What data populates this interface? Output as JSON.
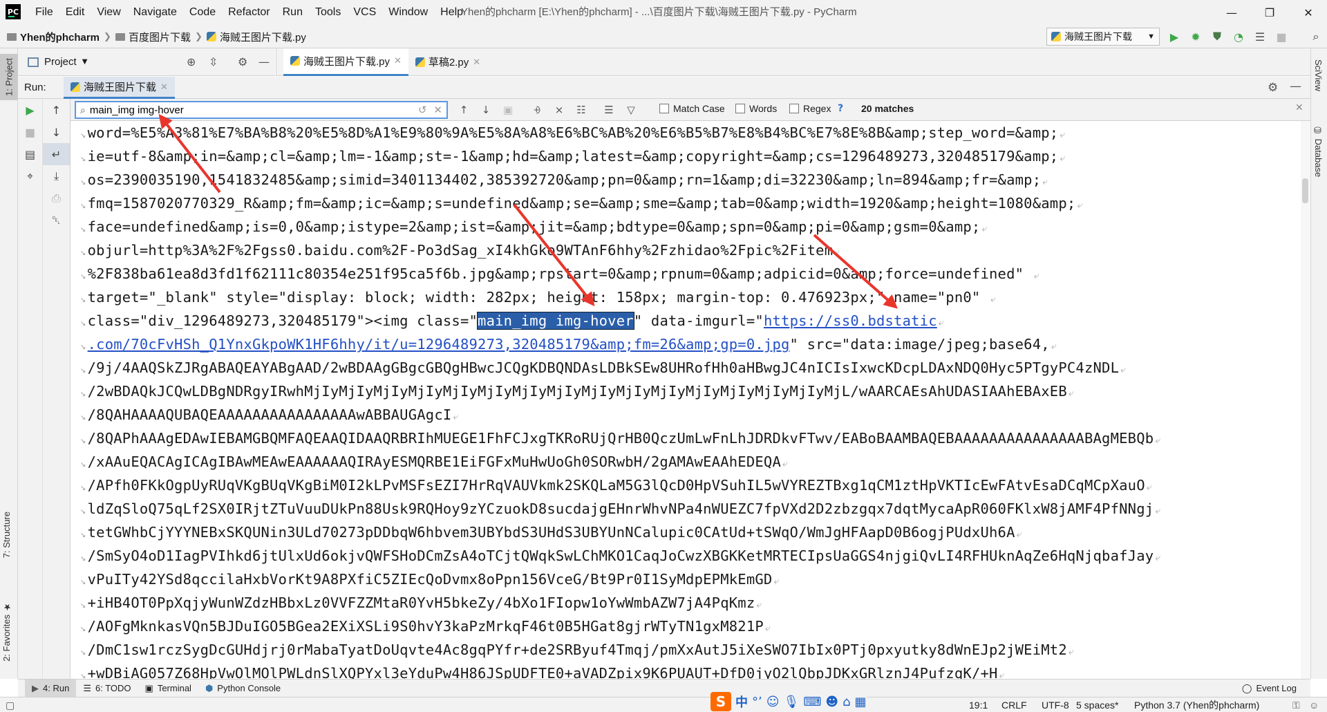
{
  "menu": [
    "File",
    "Edit",
    "View",
    "Navigate",
    "Code",
    "Refactor",
    "Run",
    "Tools",
    "VCS",
    "Window",
    "Help"
  ],
  "window_title": "Yhen的phcharm [E:\\Yhen的phcharm] - ...\\百度图片下载\\海贼王图片下载.py - PyCharm",
  "breadcrumbs": [
    "Yhen的phcharm",
    "百度图片下载",
    "海贼王图片下载.py"
  ],
  "run_config": "海贼王图片下载",
  "project": {
    "label": "Project"
  },
  "editor_tabs": [
    {
      "label": "海贼王图片下载.py",
      "active": true
    },
    {
      "label": "草稿2.py",
      "active": false
    }
  ],
  "run": {
    "label": "Run:",
    "tab": "海贼王图片下载"
  },
  "find": {
    "query": "main_img img-hover",
    "match_case": "Match Case",
    "words": "Words",
    "regex": "Regex",
    "regex_help": "?",
    "matches": "20 matches"
  },
  "console": {
    "lines": [
      "word=%E5%A3%81%E7%BA%B8%20%E5%8D%A1%E9%80%9A%E5%8A%A8%E6%BC%AB%20%E6%B5%B7%E8%B4%BC%E7%8E%8B&amp;step_word=&amp;",
      "ie=utf-8&amp;in=&amp;cl=&amp;lm=-1&amp;st=-1&amp;hd=&amp;latest=&amp;copyright=&amp;cs=1296489273,320485179&amp;",
      "os=2390035190,1541832485&amp;simid=3401134402,385392720&amp;pn=0&amp;rn=1&amp;di=32230&amp;ln=894&amp;fr=&amp;",
      "fmq=1587020770329_R&amp;fm=&amp;ic=&amp;s=undefined&amp;se=&amp;sme=&amp;tab=0&amp;width=1920&amp;height=1080&amp;",
      "face=undefined&amp;is=0,0&amp;istype=2&amp;ist=&amp;jit=&amp;bdtype=0&amp;spn=0&amp;pi=0&amp;gsm=0&amp;",
      "objurl=http%3A%2F%2Fgss0.baidu.com%2F-Po3dSag_xI4khGko9WTAnF6hhy%2Fzhidao%2Fpic%2Fitem",
      "%2F838ba61ea8d3fd1f62111c80354e251f95ca5f6b.jpg&amp;rpstart=0&amp;rpnum=0&amp;adpicid=0&amp;force=undefined\" ",
      "target=\"_blank\" style=\"display: block; width: 282px; height: 158px; margin-top: 0.476923px;\" name=\"pn0\" "
    ],
    "line9": {
      "before": "class=\"div_1296489273,320485179\"><img class=\"",
      "highlight": "main_img img-hover",
      "middle": "\" data-imgurl=\"",
      "link": "https://ss0.bdstatic"
    },
    "line10": {
      "link": ".com/70cFvHSh_Q1YnxGkpoWK1HF6hhy/it/u=1296489273,320485179&amp;fm=26&amp;gp=0.jpg",
      "after": "\" src=\"data:image/jpeg;base64,"
    },
    "lines_tail": [
      "/9j/4AAQSkZJRgABAQEAYABgAAD/2wBDAAgGBgcGBQgHBwcJCQgKDBQNDAsLDBkSEw8UHRofHh0aHBwgJC4nICIsIxwcKDcpLDAxNDQ0Hyc5PTgyPC4zNDL",
      "/2wBDAQkJCQwLDBgNDRgyIRwhMjIyMjIyMjIyMjIyMjIyMjIyMjIyMjIyMjIyMjIyMjIyMjIyMjIyMjIyMjIyMjL/wAARCAEsAhUDASIAAhEBAxEB",
      "/8QAHAAAAQUBAQEAAAAAAAAAAAAAAAAwABBAUGAgcI",
      "/8QAPhAAAgEDAwIEBAMGBQMFAQEAAQIDAAQRBRIhMUEGE1FhFCJxgTKRoRUjQrHB0QczUmLwFnLhJDRDkvFTwv/EABoBAAMBAQEBAAAAAAAAAAAAAAABAgMEBQb",
      "/xAAuEQACAgICAgIBAwMEAwEAAAAAAQIRAyESMQRBE1EiFGFxMuHwUoGh0SORwbH/2gAMAwEAAhEDEQA",
      "/APfh0FKkOgpUyRUqVKgBUqVKgBiM0I2kLPvMSFsEZI7HrRqVAUVkmk2SKQLaM5G3lQcD0HpVSuhIL5wVYREZTBxg1qCM1ztHpVKTIcEwFAtvEsaDCqMCpXauO",
      "ldZqSloQ75qLf2SX0IRjtZTuVuuDUkPn88Usk9RQHoy9zYCzuokD8sucdajgEHnrWhvNPa4nWUEZC7fpVXd2D2zbzgqx7dqtMycaApR060FKlxW8jAMF4PfNNgj",
      "tetGWhbCjYYYNEBxSKQUNin3ULd70273pDDbqW6hbvem3UBYbdS3UHdS3UBYUnNCalupic0CAtUd+tSWqO/WmJgHFAapD0B6ogjPUdxUh6A",
      "/SmSyO4oD1IagPVIhkd6jtUlxUd6okjvQWFSHoDCmZsA4oTCjtQWqkSwLChMKO1CaqJoCwzXBGKKetMRTECIpsUaGGS4njgiQvLI4RFHUknAqZe6HqNjqbafJay",
      "vPuITy42YSd8qccilaHxbVorKt9A8PXfiC5ZIEcQoDvmx8oPpn156VceG/Bt9Pr0I1SyMdpEPMkEmGD",
      "+iHB4OT0PpXqjyWunWZdzHBbxLz0VVFZZMtaR0YvH5bkeZy/4bXo1FIopw1oYwWmbAZW7jA4PqKmz",
      "/AOFgMknkasVQn5BJDuIGO5BGea2EXiXSLi9S0hvY3kaPzMrkqF46t0B5HGat8gjrWTyTN1gxM821P",
      "/DmC1sw1rczSygDcGUHdjrj0rMabaTyatDoUqvte4Ac8gqPYfr+de2SRByuf4Tmqj/pmXxAutJ5iXeSWO7IbIx0PTj0pxyutky8dWnEJp2jWEiMt2",
      "+wDBiAG057Z68HpVwOlMOlPWLdnSlXQPYxl3eYduPw4H86JSpUDFTE0+aVADZpix9K6PUAUT+DfD0jyO2lQbpJDKxGRlznJ4PufzqK/+H"
    ]
  },
  "bottom_tabs": [
    "4: Run",
    "6: TODO",
    "Terminal",
    "Python Console"
  ],
  "event_log": "Event Log",
  "side_tabs": {
    "project": "1: Project",
    "structure": "7: Structure",
    "favorites": "2: Favorites",
    "sciview": "SciView",
    "database": "Database"
  },
  "ime": {
    "logo": "S",
    "lang": "中"
  },
  "status": {
    "position": "19:1",
    "line_sep": "CRLF",
    "encoding": "UTF-8",
    "indent": "5 spaces*",
    "interpreter": "Python 3.7 (Yhen的phcharm)"
  },
  "colors": {
    "accent": "#4083c9",
    "highlight_bg": "#2a5ea9",
    "link": "#2450c5",
    "arrow": "#e8362c",
    "run_green": "#3fa84a"
  }
}
